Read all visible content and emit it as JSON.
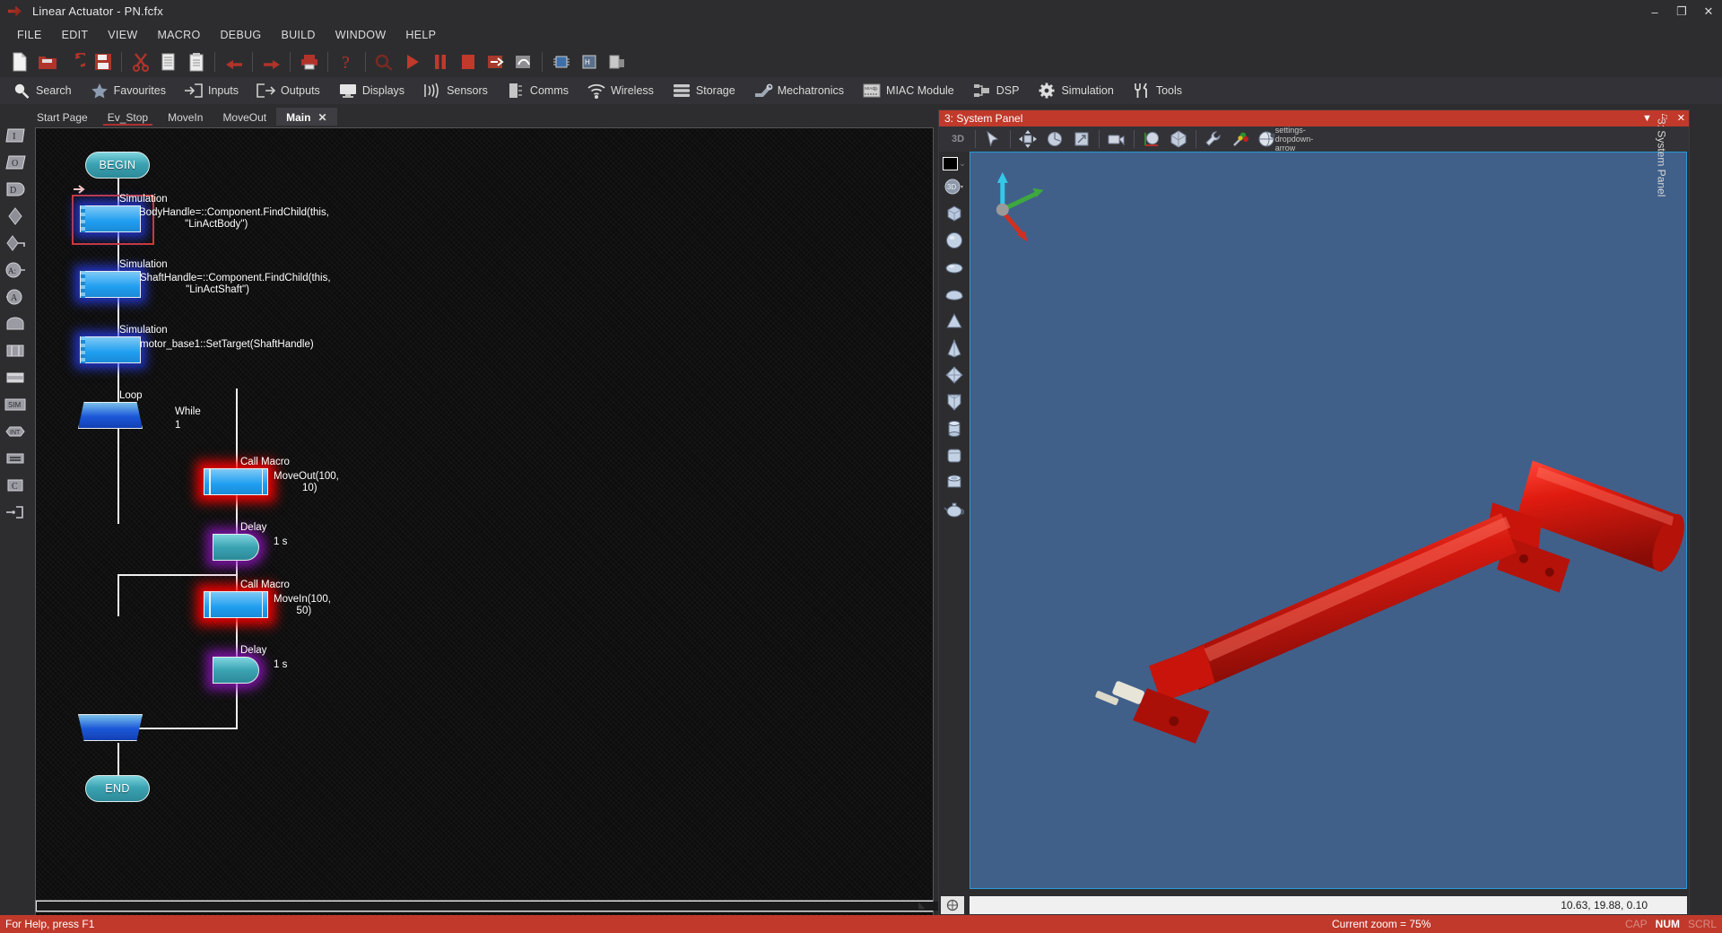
{
  "window": {
    "title": "Linear Actuator - PN.fcfx",
    "app_icon": "flowcode-icon",
    "buttons": [
      {
        "name": "minimize",
        "glyph": "–"
      },
      {
        "name": "maximize",
        "glyph": "❐"
      },
      {
        "name": "close",
        "glyph": "✕"
      }
    ]
  },
  "menu": [
    "FILE",
    "EDIT",
    "VIEW",
    "MACRO",
    "DEBUG",
    "BUILD",
    "WINDOW",
    "HELP"
  ],
  "toolbar": [
    {
      "name": "new-file-icon",
      "type": "icon"
    },
    {
      "name": "open-folder-icon",
      "type": "icon"
    },
    {
      "name": "undo-arrow-icon",
      "type": "icon"
    },
    {
      "name": "save-disk-icon",
      "type": "icon"
    },
    {
      "name": "separator",
      "type": "sep"
    },
    {
      "name": "cut-scissors-icon",
      "type": "icon"
    },
    {
      "name": "copy-icon",
      "type": "icon"
    },
    {
      "name": "paste-icon",
      "type": "icon"
    },
    {
      "name": "separator",
      "type": "sep"
    },
    {
      "name": "undo-icon",
      "type": "icon"
    },
    {
      "name": "separator",
      "type": "sep"
    },
    {
      "name": "redo-icon",
      "type": "icon"
    },
    {
      "name": "separator",
      "type": "sep"
    },
    {
      "name": "print-icon",
      "type": "icon"
    },
    {
      "name": "separator",
      "type": "sep"
    },
    {
      "name": "help-question-icon",
      "type": "icon"
    },
    {
      "name": "separator",
      "type": "sep"
    },
    {
      "name": "context-help-icon",
      "type": "icon"
    },
    {
      "name": "run-play-icon",
      "type": "icon"
    },
    {
      "name": "pause-icon",
      "type": "icon"
    },
    {
      "name": "stop-icon",
      "type": "icon"
    },
    {
      "name": "step-into-icon",
      "type": "icon"
    },
    {
      "name": "step-over-icon",
      "type": "icon"
    },
    {
      "name": "separator",
      "type": "sep"
    },
    {
      "name": "compile-chip-icon",
      "type": "icon"
    },
    {
      "name": "compile-hex-icon",
      "type": "icon"
    },
    {
      "name": "project-options-icon",
      "type": "icon"
    }
  ],
  "ribbon": [
    {
      "label": "Search",
      "icon": "magnifier-icon"
    },
    {
      "label": "Favourites",
      "icon": "star-icon"
    },
    {
      "label": "Inputs",
      "icon": "input-arrow-icon"
    },
    {
      "label": "Outputs",
      "icon": "output-arrow-icon"
    },
    {
      "label": "Displays",
      "icon": "monitor-icon"
    },
    {
      "label": "Sensors",
      "icon": "sensor-waves-icon"
    },
    {
      "label": "Comms",
      "icon": "comms-chip-icon"
    },
    {
      "label": "Wireless",
      "icon": "wifi-icon"
    },
    {
      "label": "Storage",
      "icon": "storage-stack-icon"
    },
    {
      "label": "Mechatronics",
      "icon": "robot-arm-icon"
    },
    {
      "label": "MIAC Module",
      "icon": "miac-module-icon"
    },
    {
      "label": "DSP",
      "icon": "dsp-nodes-icon"
    },
    {
      "label": "Simulation",
      "icon": "gear-icon"
    },
    {
      "label": "Tools",
      "icon": "tools-icon"
    }
  ],
  "tabs": [
    {
      "label": "Start Page",
      "active": false,
      "closable": false,
      "underline": false
    },
    {
      "label": "Ev_Stop",
      "active": false,
      "closable": false,
      "underline": true
    },
    {
      "label": "MoveIn",
      "active": false,
      "closable": false,
      "underline": false
    },
    {
      "label": "MoveOut",
      "active": false,
      "closable": false,
      "underline": false
    },
    {
      "label": "Main",
      "active": true,
      "closable": true,
      "close_glyph": "✕",
      "underline": false
    }
  ],
  "left_palette": [
    {
      "name": "input-icon",
      "glyph": "I"
    },
    {
      "name": "output-icon",
      "glyph": "O"
    },
    {
      "name": "decision-icon",
      "glyph": "D"
    },
    {
      "name": "connection-point-icon",
      "glyph": ""
    },
    {
      "name": "connection-key-icon",
      "glyph": ""
    },
    {
      "name": "string-variable-icon",
      "glyph": "A:"
    },
    {
      "name": "char-variable-icon",
      "glyph": "A"
    },
    {
      "name": "delay-icon",
      "glyph": ""
    },
    {
      "name": "loop-icon",
      "glyph": ""
    },
    {
      "name": "component-macro-icon",
      "glyph": ""
    },
    {
      "name": "simulation-icon",
      "glyph": "SIM"
    },
    {
      "name": "interrupt-icon",
      "glyph": "INT"
    },
    {
      "name": "comment-icon",
      "glyph": ""
    },
    {
      "name": "c-code-icon",
      "glyph": "C"
    },
    {
      "name": "connection-node-icon",
      "glyph": ""
    }
  ],
  "flowchart": {
    "nodes": [
      {
        "id": "begin",
        "kind": "terminal",
        "label": "BEGIN",
        "type_label": "",
        "param": "",
        "selected": false
      },
      {
        "id": "sim1",
        "kind": "simulation",
        "label": "",
        "type_label": "Simulation",
        "param": "BodyHandle=::Component.FindChild(this,\n                \"LinActBody\")",
        "selected": true
      },
      {
        "id": "sim2",
        "kind": "simulation",
        "label": "",
        "type_label": "Simulation",
        "param": "ShaftHandle=::Component.FindChild(this,\n                \"LinActShaft\")",
        "selected": false
      },
      {
        "id": "sim3",
        "kind": "simulation",
        "label": "",
        "type_label": "Simulation",
        "param": "motor_base1::SetTarget(ShaftHandle)",
        "selected": false
      },
      {
        "id": "loop",
        "kind": "loop",
        "label": "",
        "type_label": "Loop",
        "param": "",
        "condition_label": "While",
        "condition_value": "1",
        "selected": false
      },
      {
        "id": "macro1",
        "kind": "call-macro",
        "label": "",
        "type_label": "Call Macro",
        "param": "MoveOut(100,\n          10)",
        "selected": false
      },
      {
        "id": "delay1",
        "kind": "delay",
        "label": "",
        "type_label": "Delay",
        "param": "1 s",
        "selected": false
      },
      {
        "id": "macro2",
        "kind": "call-macro",
        "label": "",
        "type_label": "Call Macro",
        "param": "MoveIn(100,\n        50)",
        "selected": false
      },
      {
        "id": "delay2",
        "kind": "delay",
        "label": "",
        "type_label": "Delay",
        "param": "1 s",
        "selected": false
      },
      {
        "id": "loopend",
        "kind": "loop-end",
        "label": "",
        "type_label": "",
        "param": "",
        "selected": false
      },
      {
        "id": "end",
        "kind": "terminal",
        "label": "END",
        "type_label": "",
        "param": "",
        "selected": false
      }
    ]
  },
  "panel3d": {
    "title": "3: System Panel",
    "dock_label": "3: System Panel",
    "title_controls": [
      {
        "name": "panel-menu-dropdown",
        "glyph": "▼"
      },
      {
        "name": "panel-pin",
        "glyph": "⚐"
      },
      {
        "name": "panel-close",
        "glyph": "✕"
      }
    ],
    "toolbar": [
      {
        "name": "view-3d-toggle",
        "label": "3D"
      },
      {
        "name": "separator",
        "label": ""
      },
      {
        "name": "select-cursor-icon",
        "label": ""
      },
      {
        "name": "separator",
        "label": ""
      },
      {
        "name": "move-object-icon",
        "label": ""
      },
      {
        "name": "rotate-object-icon",
        "label": ""
      },
      {
        "name": "scale-object-icon",
        "label": ""
      },
      {
        "name": "separator",
        "label": ""
      },
      {
        "name": "camera-icon",
        "label": ""
      },
      {
        "name": "separator",
        "label": ""
      },
      {
        "name": "axes-view-icon",
        "label": ""
      },
      {
        "name": "solid-view-icon",
        "label": ""
      },
      {
        "name": "separator",
        "label": ""
      },
      {
        "name": "properties-wrench-icon",
        "label": ""
      },
      {
        "name": "paint-brush-icon",
        "label": ""
      },
      {
        "name": "global-settings-icon",
        "label": ""
      },
      {
        "name": "settings-dropdown-arrow",
        "label": "▾"
      }
    ],
    "shapes_palette": [
      {
        "name": "color-swatch",
        "glyph": ""
      },
      {
        "name": "swatch-dropdown-arrow",
        "glyph": "⌄"
      },
      {
        "name": "mode-3d-button",
        "glyph": "3D"
      },
      {
        "name": "mode-3d-dropdown",
        "glyph": "▾"
      },
      {
        "name": "cube-shape-icon",
        "glyph": ""
      },
      {
        "name": "sphere-shape-icon",
        "glyph": ""
      },
      {
        "name": "ellipsoid-shape-icon",
        "glyph": ""
      },
      {
        "name": "dome-shape-icon",
        "glyph": ""
      },
      {
        "name": "cone-shape-icon",
        "glyph": ""
      },
      {
        "name": "pointed-cone-shape-icon",
        "glyph": ""
      },
      {
        "name": "octahedron-shape-icon",
        "glyph": ""
      },
      {
        "name": "prism-shape-icon",
        "glyph": ""
      },
      {
        "name": "cylinder-shape-icon",
        "glyph": ""
      },
      {
        "name": "rounded-box-shape-icon",
        "glyph": ""
      },
      {
        "name": "tube-shape-icon",
        "glyph": ""
      },
      {
        "name": "teapot-shape-icon",
        "glyph": ""
      }
    ],
    "viewport": {
      "background_color": "#40608a",
      "model_name": "linear-actuator-model",
      "model_color": "#cc1111",
      "axis_gizmo": {
        "x_color": "#d03020",
        "y_color": "#3ea83e",
        "z_color": "#35c8e8"
      }
    },
    "coordinates": "10.63, 19.88, 0.10",
    "bottom_left_icon": "snap-grid-icon"
  },
  "statusbar": {
    "help_text": "For Help, press F1",
    "zoom_text": "Current zoom = 75%",
    "indicators": [
      {
        "label": "CAP",
        "on": false
      },
      {
        "label": "NUM",
        "on": true
      },
      {
        "label": "SCRL",
        "on": false
      }
    ]
  },
  "colors": {
    "accent_red": "#c0392b",
    "chrome": "#2d2d30",
    "ribbon": "#333337",
    "canvas": "#0d0d0d",
    "viewport": "#40608a"
  }
}
